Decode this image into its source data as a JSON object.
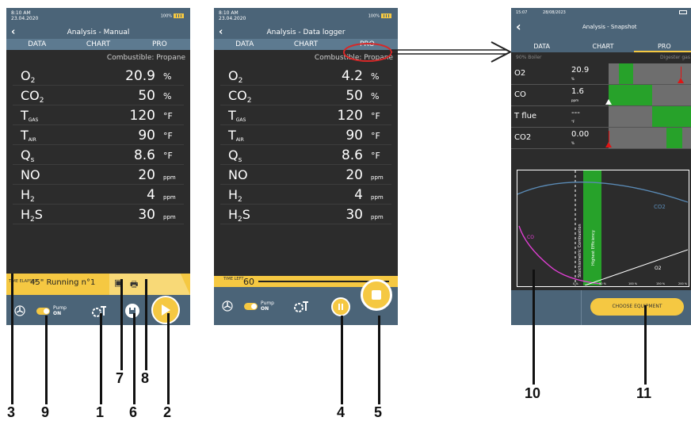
{
  "status": {
    "time": "8:10 AM",
    "date": "23.04.2020",
    "battery": "100%"
  },
  "tabs": [
    "DATA",
    "CHART",
    "PRO"
  ],
  "combustible": "Combustible: Propane",
  "screen1": {
    "title": "Analysis - Manual",
    "rows": [
      {
        "name": "O",
        "sub": "2",
        "value": "20.9",
        "unit": "%"
      },
      {
        "name": "CO",
        "sub": "2",
        "value": "50",
        "unit": "%"
      },
      {
        "name": "T",
        "sub": "GAS",
        "value": "120",
        "unit": "°F"
      },
      {
        "name": "T",
        "sub": "AIR",
        "value": "90",
        "unit": "°F"
      },
      {
        "name": "Q",
        "sub": "s",
        "value": "8.6",
        "unit": "°F"
      },
      {
        "name": "NO",
        "sub": "",
        "value": "20",
        "unit": "ppm"
      },
      {
        "name": "H",
        "sub": "2",
        "value": "4",
        "unit": "ppm"
      },
      {
        "name": "H",
        "sub": "2",
        "name2": "S",
        "value": "30",
        "unit": "ppm"
      }
    ],
    "time_elapsed_label": "TIME ELAPSED",
    "running": "45\" Running n°1",
    "pump_label": "Pump",
    "pump_state": "ON"
  },
  "screen2": {
    "title": "Analysis - Data logger",
    "rows": [
      {
        "name": "O",
        "sub": "2",
        "value": "4.2",
        "unit": "%"
      },
      {
        "name": "CO",
        "sub": "2",
        "value": "50",
        "unit": "%"
      },
      {
        "name": "T",
        "sub": "GAS",
        "value": "120",
        "unit": "°F"
      },
      {
        "name": "T",
        "sub": "AIR",
        "value": "90",
        "unit": "°F"
      },
      {
        "name": "Q",
        "sub": "s",
        "value": "8.6",
        "unit": "°F"
      },
      {
        "name": "NO",
        "sub": "",
        "value": "20",
        "unit": "ppm"
      },
      {
        "name": "H",
        "sub": "2",
        "value": "4",
        "unit": "ppm"
      },
      {
        "name": "H",
        "sub": "2",
        "name2": "S",
        "value": "30",
        "unit": "ppm"
      }
    ],
    "time_left_label": "TIME LEFT",
    "time_left_value": "60",
    "pump_label": "Pump",
    "pump_state": "ON"
  },
  "screen3": {
    "time": "15:07",
    "date": "28/08/2023",
    "title": "Analysis - Snapshot",
    "left_sub": "90% Boiler",
    "right_sub": "Digester gas",
    "rows": [
      {
        "name": "O2",
        "value": "20.9",
        "unit": "%"
      },
      {
        "name": "CO",
        "value": "1.6",
        "unit": "ppm"
      },
      {
        "name": "T flue",
        "value": "---",
        "unit": "°F"
      },
      {
        "name": "CO2",
        "value": "0.00",
        "unit": "%"
      }
    ],
    "graph": {
      "stoich_label": "Stoichiometric Combustion",
      "efficiency_label": "Highest Efficiency",
      "series": [
        "CO2",
        "CO",
        "O2"
      ],
      "x_ticks": [
        "0 %",
        "50 %",
        "100 %",
        "150 %",
        "200 %"
      ]
    },
    "button": "CHOOSE EQUIPMENT"
  },
  "callouts": [
    "1",
    "2",
    "3",
    "4",
    "5",
    "6",
    "7",
    "8",
    "9",
    "10",
    "11"
  ],
  "colors": {
    "header": "#4b6478",
    "tabs": "#5d7a90",
    "body": "#2c2c2c",
    "accent": "#f5c842",
    "green": "#27a22a",
    "red": "#e01414"
  }
}
